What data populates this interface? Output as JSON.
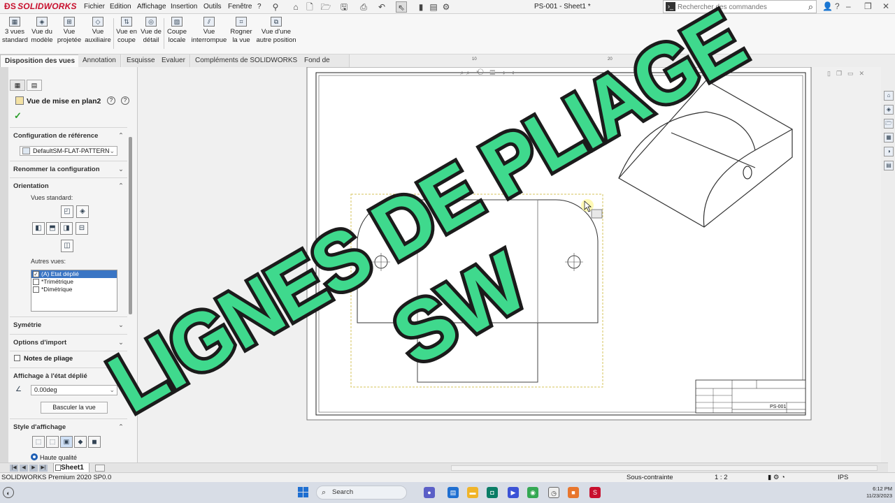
{
  "app": {
    "logo_text": "SOLIDWORKS",
    "document_title": "PS-001 - Sheet1 *"
  },
  "menu": [
    "Fichier",
    "Edition",
    "Affichage",
    "Insertion",
    "Outils",
    "Fenêtre",
    "?"
  ],
  "search": {
    "placeholder": "Rechercher des commandes"
  },
  "commands": [
    {
      "line1": "3 vues",
      "line2": "standard"
    },
    {
      "line1": "Vue du",
      "line2": "modèle"
    },
    {
      "line1": "Vue",
      "line2": "projetée"
    },
    {
      "line1": "Vue",
      "line2": "auxiliaire"
    },
    {
      "line1": "Vue en",
      "line2": "coupe"
    },
    {
      "line1": "Vue de",
      "line2": "détail"
    },
    {
      "line1": "Coupe",
      "line2": "locale"
    },
    {
      "line1": "Vue",
      "line2": "interrompue"
    },
    {
      "line1": "Rogner",
      "line2": "la vue"
    },
    {
      "line1": "Vue d'une",
      "line2": "autre position"
    }
  ],
  "tabs": [
    "Disposition des vues",
    "Annotation",
    "Esquisse",
    "Evaluer",
    "Compléments de SOLIDWORKS",
    "Fond de plan"
  ],
  "property_manager": {
    "title": "Vue de mise en plan2",
    "sections": {
      "ref_config": "Configuration de référence",
      "ref_config_value": "DefaultSM-FLAT-PATTERN",
      "rename_config": "Renommer la configuration",
      "orientation": "Orientation",
      "standard_views": "Vues standard:",
      "other_views": "Autres vues:",
      "other_views_items": [
        "(A) Etat déplié",
        "*Trimétrique",
        "*Dimétrique"
      ],
      "symmetry": "Symétrie",
      "import_options": "Options d'import",
      "bend_notes": "Notes de pliage",
      "flat_display": "Affichage à l'état déplié",
      "angle_value": "0.00deg",
      "toggle_button": "Basculer la vue",
      "display_style": "Style d'affichage",
      "high_quality": "Haute qualité"
    }
  },
  "sheet_tab": "Sheet1",
  "status": {
    "product": "SOLIDWORKS Premium 2020 SP0.0",
    "state": "Sous-contrainte",
    "scale": "1 : 2",
    "units": "IPS"
  },
  "drawing": {
    "title_block_number": "PS-001",
    "ruler_labels": [
      "10",
      "20"
    ]
  },
  "taskbar": {
    "search_label": "Search",
    "time": "6:12 PM",
    "date": "11/23/2023"
  },
  "overlay": {
    "line1": "LIGNES DE PLIAGE",
    "line2": "SW"
  },
  "colors": {
    "overlay_fill": "#3fd98d",
    "overlay_stroke": "#1b1b1b",
    "accent_red": "#c8102e",
    "selection_blue": "#3a75c4"
  }
}
